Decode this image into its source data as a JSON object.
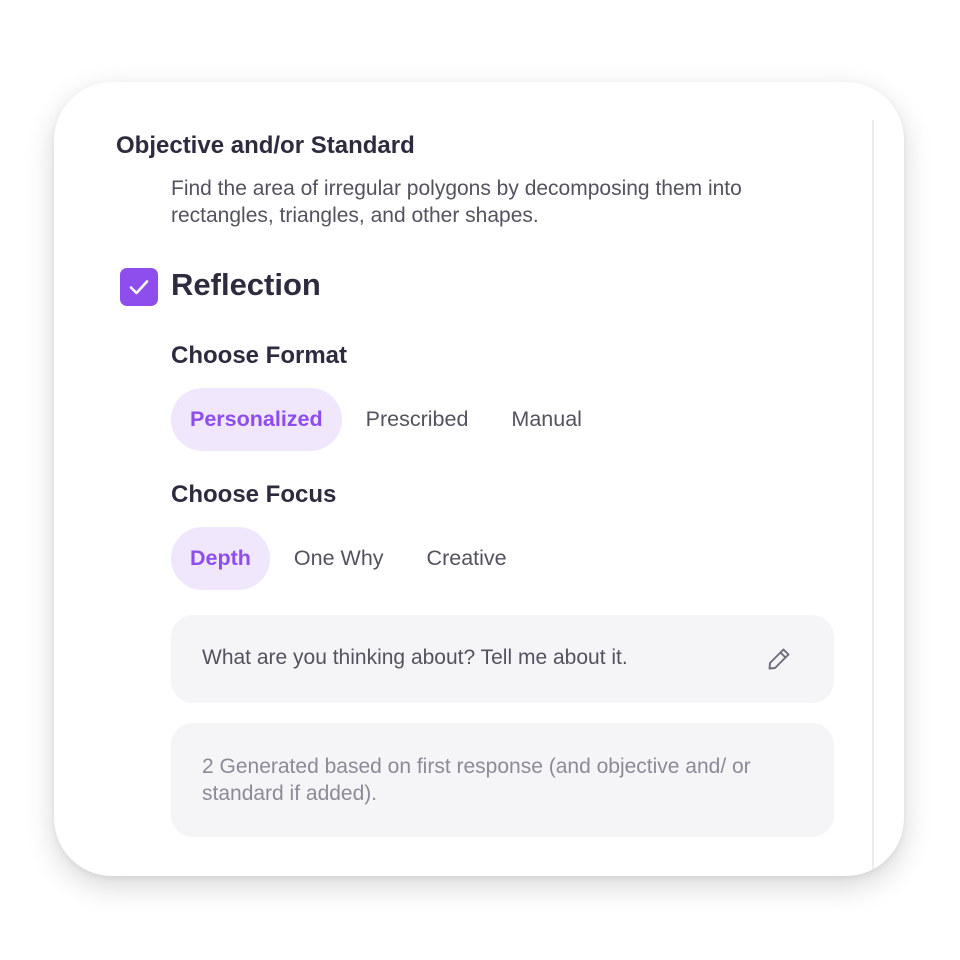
{
  "objective": {
    "title": "Objective and/or Standard",
    "text": "Find the area of irregular polygons by decomposing them into rectangles, triangles, and other shapes."
  },
  "reflection": {
    "label": "Reflection",
    "checked": true,
    "checkbox_icon": "check-icon"
  },
  "format": {
    "title": "Choose Format",
    "options": [
      "Personalized",
      "Prescribed",
      "Manual"
    ],
    "selected": "Personalized"
  },
  "focus": {
    "title": "Choose Focus",
    "options": [
      "Depth",
      "One Why",
      "Creative"
    ],
    "selected": "Depth"
  },
  "prompt": {
    "text": "What are you thinking about? Tell me about it.",
    "icon": "pencil-icon"
  },
  "generated": {
    "text": "2 Generated based on first response (and objective and/ or standard if added)."
  },
  "colors": {
    "accent": "#8e4ded",
    "accent_light": "#f0e7fd",
    "heading": "#2e2b3f",
    "body": "#55525f",
    "muted": "#8d8a98",
    "box_bg": "#f5f5f8"
  }
}
